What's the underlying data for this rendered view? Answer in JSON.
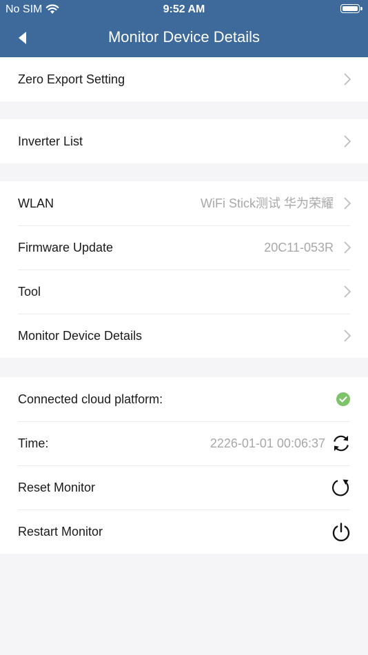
{
  "status_bar": {
    "carrier": "No SIM",
    "time": "9:52 AM"
  },
  "header": {
    "title": "Monitor Device Details"
  },
  "groups": {
    "g1": {
      "zero_export": {
        "label": "Zero Export Setting"
      }
    },
    "g2": {
      "inverter_list": {
        "label": "Inverter List"
      }
    },
    "g3": {
      "wlan": {
        "label": "WLAN",
        "value": "WiFi Stick测试 华为荣耀"
      },
      "firmware": {
        "label": "Firmware Update",
        "value": "20C11-053R"
      },
      "tool": {
        "label": "Tool"
      },
      "monitor_details": {
        "label": "Monitor Device Details"
      }
    },
    "g4": {
      "cloud": {
        "label": "Connected cloud platform:"
      },
      "time": {
        "label": "Time:",
        "value": "2226-01-01 00:06:37"
      },
      "reset": {
        "label": "Reset Monitor"
      },
      "restart": {
        "label": "Restart Monitor"
      }
    }
  },
  "colors": {
    "header": "#3d6a9b",
    "background": "#f5f5f7",
    "status_ok": "#7cc36a"
  },
  "icons": {
    "back": "chevron-left-icon",
    "row_arrow": "chevron-right-icon",
    "cloud_status": "check-circle-icon",
    "time_sync": "refresh-icon",
    "reset": "reset-icon",
    "restart": "power-icon"
  }
}
